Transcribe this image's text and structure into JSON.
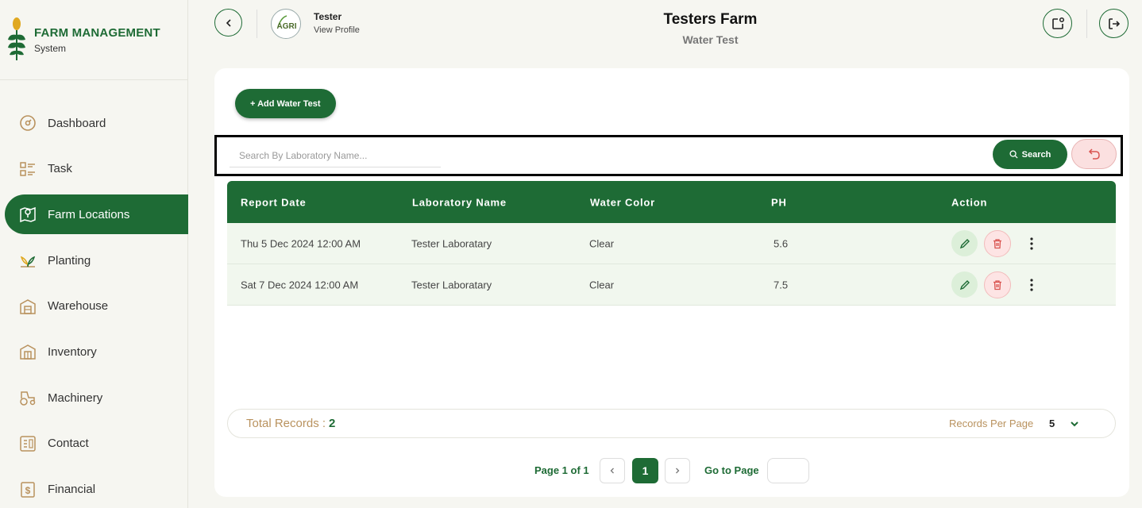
{
  "brand": {
    "title": "FARM MANAGEMENT",
    "subtitle": "System"
  },
  "sidebar": {
    "items": [
      {
        "label": "Dashboard",
        "icon": "gauge-icon",
        "active": false
      },
      {
        "label": "Task",
        "icon": "task-list-icon",
        "active": false
      },
      {
        "label": "Farm Locations",
        "icon": "map-pin-icon",
        "active": true
      },
      {
        "label": "Planting",
        "icon": "sprout-icon",
        "active": false
      },
      {
        "label": "Warehouse",
        "icon": "warehouse-icon",
        "active": false
      },
      {
        "label": "Inventory",
        "icon": "inventory-icon",
        "active": false
      },
      {
        "label": "Machinery",
        "icon": "tractor-icon",
        "active": false
      },
      {
        "label": "Contact",
        "icon": "contact-card-icon",
        "active": false
      },
      {
        "label": "Financial",
        "icon": "dollar-doc-icon",
        "active": false
      }
    ]
  },
  "header": {
    "user_name": "Tester",
    "view_profile": "View Profile",
    "avatar_text": "AGRI",
    "farm_title": "Testers Farm",
    "page_subtitle": "Water Test"
  },
  "toolbar": {
    "add_label": "+ Add Water Test"
  },
  "search": {
    "placeholder": "Search By Laboratory Name...",
    "button_label": "Search"
  },
  "table": {
    "columns": [
      "Report Date",
      "Laboratory Name",
      "Water Color",
      "PH",
      "Action"
    ],
    "rows": [
      {
        "report_date": "Thu 5 Dec 2024 12:00 AM",
        "laboratory": "Tester Laboratary",
        "water_color": "Clear",
        "ph": "5.6"
      },
      {
        "report_date": "Sat 7 Dec 2024 12:00 AM",
        "laboratory": "Tester Laboratary",
        "water_color": "Clear",
        "ph": "7.5"
      }
    ]
  },
  "footer": {
    "total_label": "Total Records :",
    "total_value": "2",
    "per_page_label": "Records Per Page",
    "per_page_value": "5",
    "page_label": "Page 1 of 1",
    "current_page": "1",
    "goto_label": "Go to Page"
  },
  "colors": {
    "primary": "#1e6b35",
    "accent_gold": "#b9925e",
    "danger_bg": "#fde4e4"
  }
}
